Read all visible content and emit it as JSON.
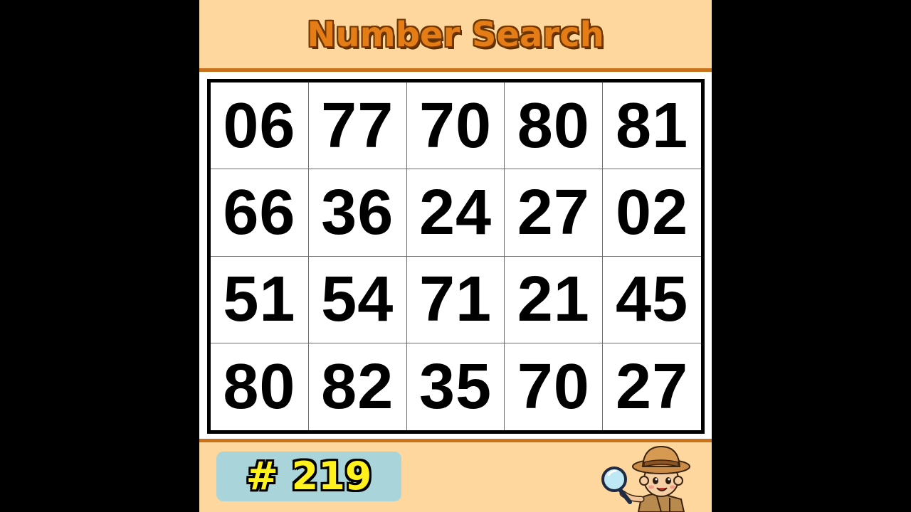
{
  "title": "Number Search",
  "grid": {
    "rows": [
      [
        "06",
        "77",
        "70",
        "80",
        "81"
      ],
      [
        "66",
        "36",
        "24",
        "27",
        "02"
      ],
      [
        "51",
        "54",
        "71",
        "21",
        "45"
      ],
      [
        "80",
        "82",
        "35",
        "70",
        "27"
      ]
    ]
  },
  "puzzle_number": "# 219",
  "colors": {
    "background": "#fdd79e",
    "title": "#e57d17",
    "rule": "#c9721b",
    "badge_bg": "#a9d5da",
    "badge_text": "#fff21c"
  },
  "icons": {
    "explorer": "explorer-with-magnifying-glass-icon"
  }
}
